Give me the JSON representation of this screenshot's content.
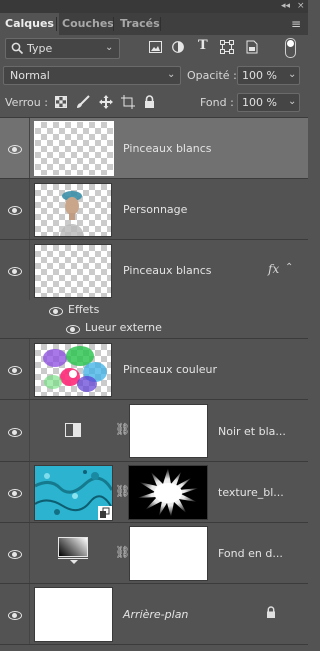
{
  "panel": {
    "tabs": [
      "Calques",
      "Couches",
      "Tracés"
    ],
    "collapse_glyph": "◂◂",
    "close_glyph": "×",
    "menu_glyph": "≡"
  },
  "filter": {
    "kind_label": "Type",
    "icons": [
      "image-filter-icon",
      "adjustment-filter-icon",
      "text-filter-icon",
      "shape-filter-icon",
      "smartobject-filter-icon"
    ]
  },
  "blend": {
    "mode": "Normal",
    "opacity_label": "Opacité :",
    "opacity_value": "100 %"
  },
  "lock": {
    "label": "Verrou :",
    "fill_label": "Fond :",
    "fill_value": "100 %"
  },
  "layers": [
    {
      "name": "Pinceaux blancs",
      "selected": true
    },
    {
      "name": "Personnage"
    },
    {
      "name": "Pinceaux blancs",
      "fx": "fx",
      "effects_label": "Effets",
      "effect_item": "Lueur externe"
    },
    {
      "name": "Pinceaux couleur"
    },
    {
      "name": "Noir et bla..."
    },
    {
      "name": "texture_bl..."
    },
    {
      "name": "Fond en d..."
    },
    {
      "name": "Arrière-plan"
    }
  ]
}
